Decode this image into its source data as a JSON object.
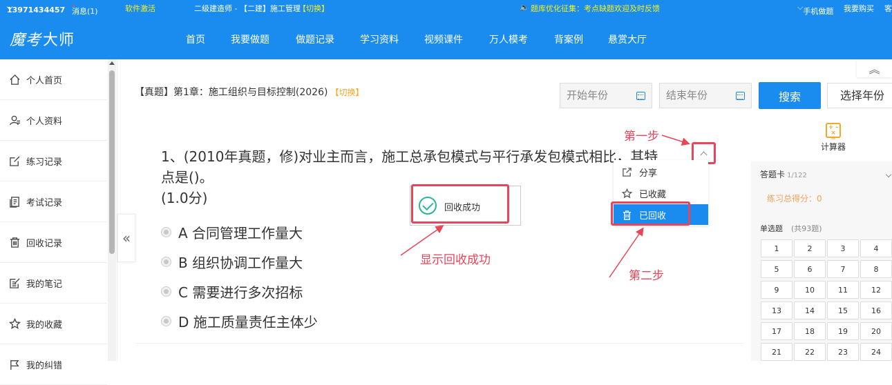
{
  "topbar": {
    "phone": "13971434457",
    "messages": "消息(1)",
    "activate": "软件激活",
    "course_prefix": "二级建造师 - 【二建】施工管理",
    "course_switch": "【切换】",
    "notice": "题库优化征集：考点缺题欢迎及时反馈",
    "mobile": "手机做题",
    "buy": "我要购买",
    "more": "客"
  },
  "logo": {
    "script": "魔考",
    "text": "大师"
  },
  "nav": [
    "首页",
    "我要做题",
    "做题记录",
    "学习资料",
    "视频课件",
    "万人模考",
    "背案例",
    "悬赏大厅"
  ],
  "sidebar": [
    {
      "label": "个人首页",
      "icon": "home-icon"
    },
    {
      "label": "个人资料",
      "icon": "user-icon"
    },
    {
      "label": "练习记录",
      "icon": "edit-icon"
    },
    {
      "label": "考试记录",
      "icon": "document-icon"
    },
    {
      "label": "回收记录",
      "icon": "trash-icon"
    },
    {
      "label": "我的笔记",
      "icon": "note-icon"
    },
    {
      "label": "我的收藏",
      "icon": "star-icon"
    },
    {
      "label": "我的纠错",
      "icon": "flag-icon"
    }
  ],
  "header": {
    "title": "【真题】第1章：施工组织与目标控制(2026)",
    "switch": "【切换】",
    "start_year_placeholder": "开始年份",
    "end_year_placeholder": "结束年份",
    "search": "搜索",
    "select_year": "选择年份"
  },
  "question": {
    "text": "1、(2010年真题，修)对业主而言，施工总承包模式与平行承发包模式相比，其特点是()。",
    "score": "(1.0分)",
    "options": [
      "A 合同管理工作量大",
      "B 组织协调工作量大",
      "C 需要进行多次招标",
      "D 施工质量责任主体少"
    ]
  },
  "toast": {
    "text": "回收成功"
  },
  "menu": {
    "share": "分享",
    "favorited": "已收藏",
    "recycled": "已回收"
  },
  "annotations": {
    "step1": "第一步",
    "step2": "第二步",
    "success": "显示回收成功"
  },
  "right_panel": {
    "calculator": "计算器",
    "answer_card": "答题卡",
    "progress": "1/122",
    "score": "练习总得分：0",
    "single_choice": "单选题",
    "single_count": "(共93题)",
    "numbers": [
      "1",
      "2",
      "3",
      "4",
      "5",
      "6",
      "7",
      "8",
      "9",
      "10",
      "11",
      "12",
      "13",
      "14",
      "15",
      "16",
      "17",
      "18",
      "19",
      "20",
      "21",
      "22",
      "23",
      "24"
    ]
  },
  "colors": {
    "primary": "#1a8cf0",
    "annotation": "#e8455a",
    "success": "#29b59a",
    "highlight": "#f3f01e"
  }
}
